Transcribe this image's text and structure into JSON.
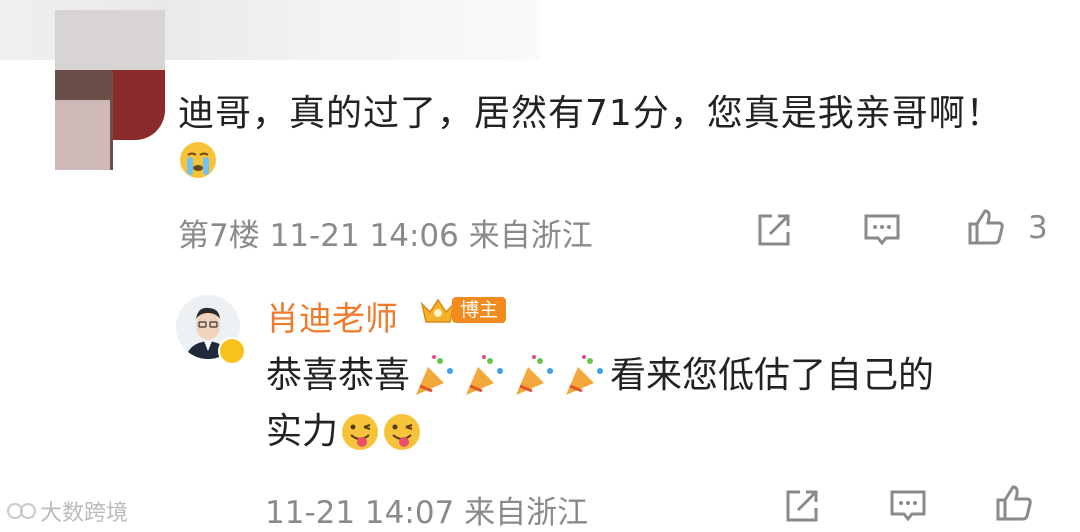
{
  "comment": {
    "text": "迪哥，真的过了，居然有71分，您真是我亲哥啊！",
    "emoji": "crying-face",
    "floor": "第7楼",
    "timestamp": "11-21 14:06",
    "location": "来自浙江",
    "like_count": "3"
  },
  "reply": {
    "author": "肖迪老师",
    "badge_label": "博主",
    "line1_text_a": "恭喜恭喜",
    "line1_text_b": "看来您低估了自己的",
    "line2_text": "实力",
    "timestamp": "11-21 14:07",
    "location": "来自浙江"
  },
  "watermark": {
    "text": "大数跨境"
  },
  "colors": {
    "name_orange": "#f07a2b",
    "meta_gray": "#8a8a8a",
    "badge_orange": "#f28a1e"
  }
}
